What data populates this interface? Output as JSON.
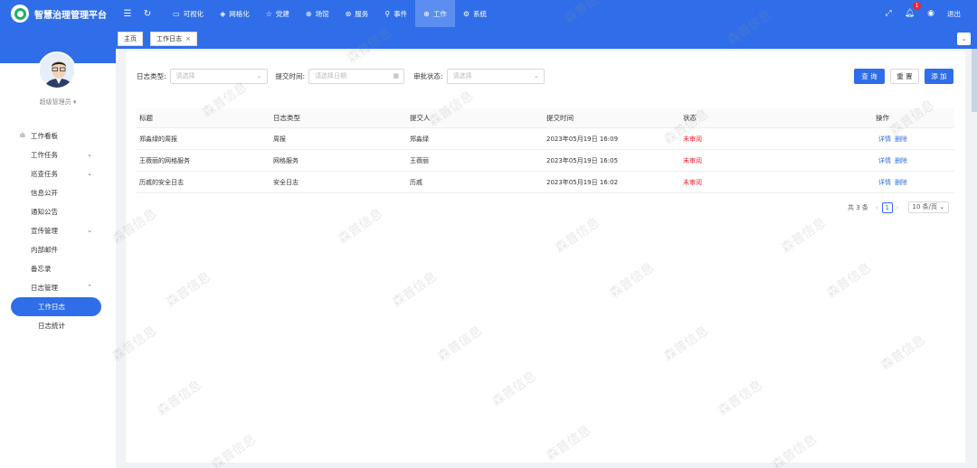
{
  "app": {
    "title": "智慧治理管理平台"
  },
  "nav": [
    {
      "icon": "▭",
      "label": "可视化"
    },
    {
      "icon": "◈",
      "label": "网格化"
    },
    {
      "icon": "☆",
      "label": "党建"
    },
    {
      "icon": "⊕",
      "label": "场馆"
    },
    {
      "icon": "⊛",
      "label": "服务"
    },
    {
      "icon": "⚲",
      "label": "事件"
    },
    {
      "icon": "⊕",
      "label": "工作"
    },
    {
      "icon": "⚙",
      "label": "系统"
    }
  ],
  "header": {
    "notification_count": "1",
    "logout_label": "退出"
  },
  "user": {
    "name": "超级管理员"
  },
  "menu": {
    "work_board": "工作看板",
    "work_task": "工作任务",
    "patrol_task": "巡查任务",
    "info_public": "信息公开",
    "notice": "通知公告",
    "propaganda": "宣传管理",
    "internal_mail": "内部邮件",
    "memo": "备忘录",
    "log_manage": "日志管理",
    "work_log": "工作日志",
    "log_stats": "日志统计"
  },
  "tabs": {
    "home": "主页",
    "work_log": "工作日志"
  },
  "filters": {
    "type_label": "日志类型:",
    "type_placeholder": "请选择",
    "time_label": "提交时间:",
    "time_placeholder": "请选择日期",
    "status_label": "审批状态:",
    "status_placeholder": "请选择"
  },
  "buttons": {
    "search": "查 询",
    "reset": "重 置",
    "add": "添 加"
  },
  "table": {
    "headers": [
      "标题",
      "日志类型",
      "提交人",
      "提交时间",
      "状态",
      "操作"
    ],
    "rows": [
      {
        "title": "郑淼绿的周报",
        "type": "周报",
        "submitter": "郑淼绿",
        "time": "2023年05月19日 16:09",
        "status": "未审阅"
      },
      {
        "title": "王薇丽的网格服务",
        "type": "网格服务",
        "submitter": "王薇丽",
        "time": "2023年05月19日 16:05",
        "status": "未审阅"
      },
      {
        "title": "历戚的安全日志",
        "type": "安全日志",
        "submitter": "历戚",
        "time": "2023年05月19日 16:02",
        "status": "未审阅"
      }
    ],
    "op_detail": "详情",
    "op_delete": "删除"
  },
  "pagination": {
    "total": "共 3 条",
    "page": "1",
    "page_size": "10 条/页"
  },
  "watermark": "森普信息",
  "colors": {
    "primary": "#2f6ee8",
    "danger": "#f5222d"
  }
}
